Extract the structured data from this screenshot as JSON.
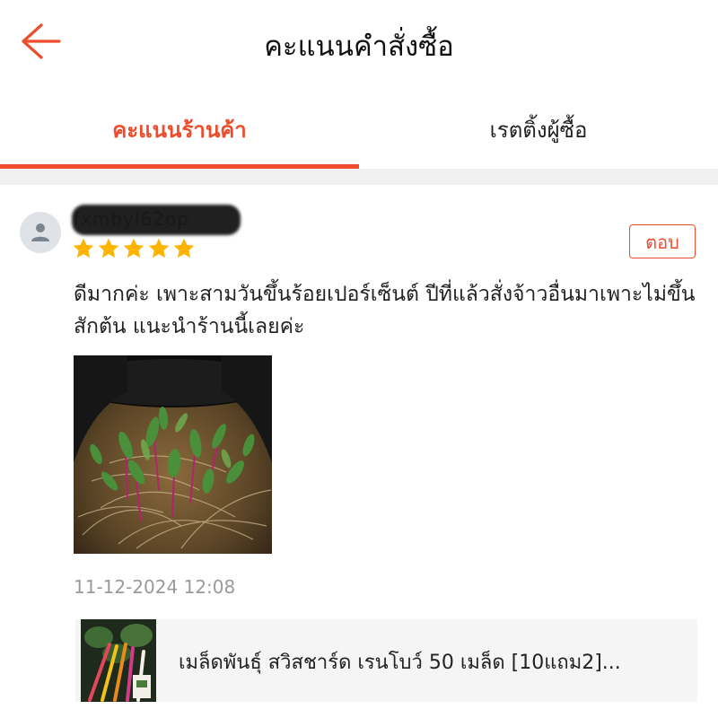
{
  "header": {
    "title": "คะแนนคำสั่งซื้อ",
    "back_icon": "arrow-left-icon",
    "accent_color": "#ee4d2d"
  },
  "tabs": [
    {
      "label": "คะแนนร้านค้า",
      "active": true
    },
    {
      "label": "เรตติ้งผู้ซื้อ",
      "active": false
    }
  ],
  "review": {
    "username": "fxmbyl62op",
    "rating": 5,
    "max_rating": 5,
    "reply_label": "ตอบ",
    "comment": "ดีมากค่ะ เพาะสามวันขึ้นร้อยเปอร์เซ็นต์  ปีที่แล้วสั่งจ้าวอื่นมาเพาะไม่ขึ้นสักต้น  แนะนำร้านนี้เลยค่ะ",
    "timestamp": "11-12-2024 12:08"
  },
  "product": {
    "name": "เมล็ดพันธุ์ สวิสชาร์ด เรนโบว์ 50 เมล็ด [10แถม2]..."
  }
}
